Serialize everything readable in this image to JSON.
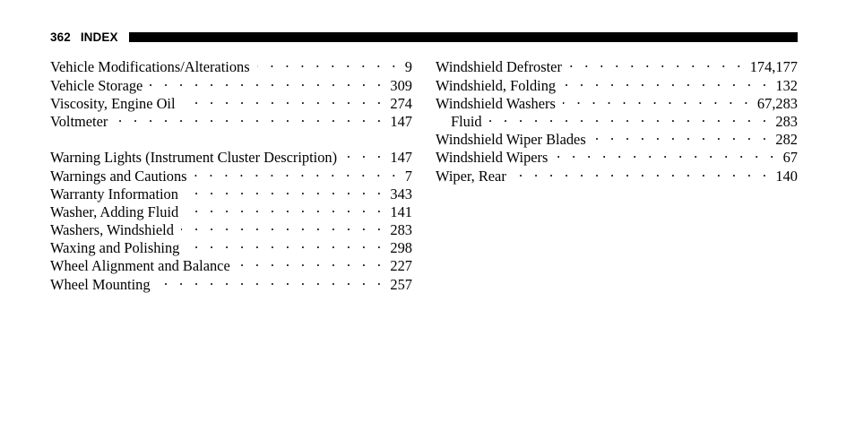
{
  "header": {
    "page_number": "362",
    "section_label": "INDEX",
    "rule_color": "#000000"
  },
  "columns": {
    "left": {
      "groups": [
        {
          "entries": [
            {
              "title": "Vehicle Modifications/Alterations",
              "page": "9",
              "sub": false
            },
            {
              "title": "Vehicle Storage",
              "page": "309",
              "sub": false
            },
            {
              "title": "Viscosity, Engine Oil",
              "page": "274",
              "sub": false
            },
            {
              "title": "Voltmeter",
              "page": "147",
              "sub": false
            }
          ]
        },
        {
          "entries": [
            {
              "title": "Warning Lights (Instrument Cluster Description)",
              "page": "147",
              "sub": false
            },
            {
              "title": "Warnings and Cautions",
              "page": "7",
              "sub": false
            },
            {
              "title": "Warranty Information",
              "page": "343",
              "sub": false
            },
            {
              "title": "Washer, Adding Fluid",
              "page": "141",
              "sub": false
            },
            {
              "title": "Washers, Windshield",
              "page": "283",
              "sub": false
            },
            {
              "title": "Waxing and Polishing",
              "page": "298",
              "sub": false
            },
            {
              "title": "Wheel Alignment and Balance",
              "page": "227",
              "sub": false
            },
            {
              "title": "Wheel Mounting",
              "page": "257",
              "sub": false
            }
          ]
        }
      ]
    },
    "right": {
      "groups": [
        {
          "entries": [
            {
              "title": "Windshield Defroster",
              "page": "174,177",
              "sub": false
            },
            {
              "title": "Windshield, Folding",
              "page": "132",
              "sub": false
            },
            {
              "title": "Windshield Washers",
              "page": "67,283",
              "sub": false
            },
            {
              "title": "Fluid",
              "page": "283",
              "sub": true
            },
            {
              "title": "Windshield Wiper Blades",
              "page": "282",
              "sub": false
            },
            {
              "title": "Windshield Wipers",
              "page": "67",
              "sub": false
            },
            {
              "title": "Wiper, Rear",
              "page": "140",
              "sub": false
            }
          ]
        }
      ]
    }
  }
}
